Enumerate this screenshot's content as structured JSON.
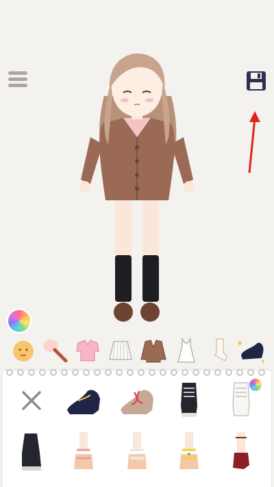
{
  "screen": "dress-up editor",
  "toolbar": {
    "menu_icon": "hamburger-menu-icon",
    "save_icon": "floppy-disk-save-icon",
    "color_icon": "color-wheel-icon"
  },
  "categories": [
    {
      "name": "face",
      "icon": "face-icon"
    },
    {
      "name": "hair",
      "icon": "hair-brush-icon"
    },
    {
      "name": "top",
      "icon": "blouse-icon"
    },
    {
      "name": "skirt",
      "icon": "skirt-icon"
    },
    {
      "name": "jacket",
      "icon": "cardigan-icon"
    },
    {
      "name": "dress",
      "icon": "dress-icon"
    },
    {
      "name": "socks",
      "icon": "sock-icon"
    },
    {
      "name": "shoes",
      "icon": "shoe-icon",
      "active": true
    }
  ],
  "shoe_items": [
    {
      "icon": "remove-x-icon"
    },
    {
      "icon": "navy-mary-jane-shoe-icon"
    },
    {
      "icon": "beige-mary-jane-shoe-icon"
    },
    {
      "icon": "black-sneaker-icon"
    },
    {
      "icon": "white-sneaker-icon"
    },
    {
      "icon": "black-sneaker-side-icon"
    },
    {
      "icon": "pink-sandal-icon"
    },
    {
      "icon": "white-sandal-icon"
    },
    {
      "icon": "yellow-sandal-icon"
    },
    {
      "icon": "red-heel-icon"
    }
  ],
  "colors": {
    "background": "#f3f2ee",
    "cardigan": "#9b6a55",
    "hair": "#c8a48c",
    "annotation_arrow": "#e0241d",
    "save_icon": "#2c3150"
  }
}
